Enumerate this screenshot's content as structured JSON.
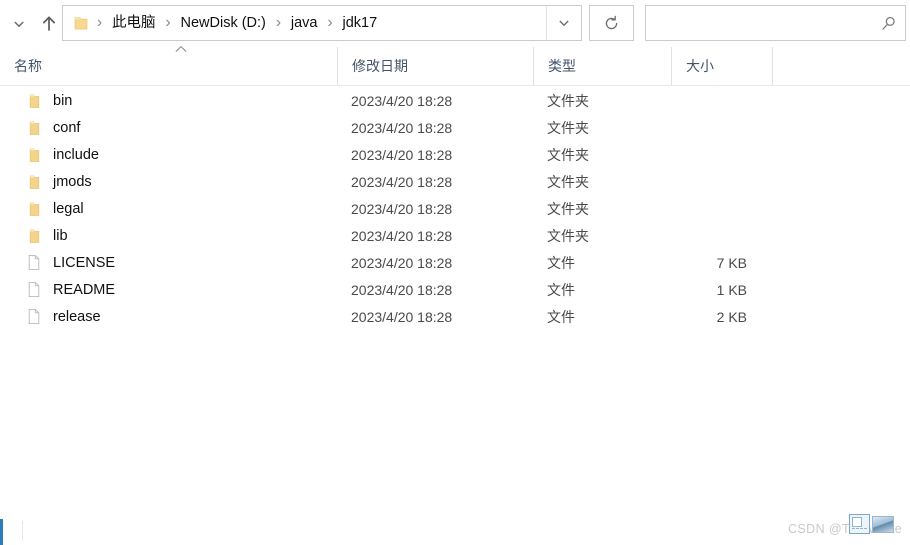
{
  "window": {
    "title": "jdk17"
  },
  "nav": {
    "recent_locations_label": "Recent locations",
    "up_label": "Up to NewDisk (D:)\\java",
    "refresh_label": "Refresh",
    "dropdown_label": "Previous locations"
  },
  "address": {
    "folder_icon": "folder-icon",
    "separator": "›",
    "crumbs": [
      {
        "label": "此电脑"
      },
      {
        "label": "NewDisk (D:)"
      },
      {
        "label": "java"
      },
      {
        "label": "jdk17"
      }
    ]
  },
  "search": {
    "value": "",
    "placeholder": "",
    "icon": "search-icon"
  },
  "columns": {
    "name": "名称",
    "date_modified": "修改日期",
    "type": "类型",
    "size": "大小",
    "sort_indicator": "ascending"
  },
  "files": [
    {
      "name": "bin",
      "date": "2023/4/20 18:28",
      "type": "文件夹",
      "size": "",
      "icon": "folder-icon"
    },
    {
      "name": "conf",
      "date": "2023/4/20 18:28",
      "type": "文件夹",
      "size": "",
      "icon": "folder-icon"
    },
    {
      "name": "include",
      "date": "2023/4/20 18:28",
      "type": "文件夹",
      "size": "",
      "icon": "folder-icon"
    },
    {
      "name": "jmods",
      "date": "2023/4/20 18:28",
      "type": "文件夹",
      "size": "",
      "icon": "folder-icon"
    },
    {
      "name": "legal",
      "date": "2023/4/20 18:28",
      "type": "文件夹",
      "size": "",
      "icon": "folder-icon"
    },
    {
      "name": "lib",
      "date": "2023/4/20 18:28",
      "type": "文件夹",
      "size": "",
      "icon": "folder-icon"
    },
    {
      "name": "LICENSE",
      "date": "2023/4/20 18:28",
      "type": "文件",
      "size": "7 KB",
      "icon": "file-icon"
    },
    {
      "name": "README",
      "date": "2023/4/20 18:28",
      "type": "文件",
      "size": "1 KB",
      "icon": "file-icon"
    },
    {
      "name": "release",
      "date": "2023/4/20 18:28",
      "type": "文件",
      "size": "2 KB",
      "icon": "file-icon"
    }
  ],
  "watermark": {
    "text": "CSDN @Ts白White"
  },
  "colors": {
    "folder": "#f7d68a",
    "accent": "#2b7cb8",
    "header_text": "#44546a",
    "secondary_text": "#4a4a4a"
  }
}
